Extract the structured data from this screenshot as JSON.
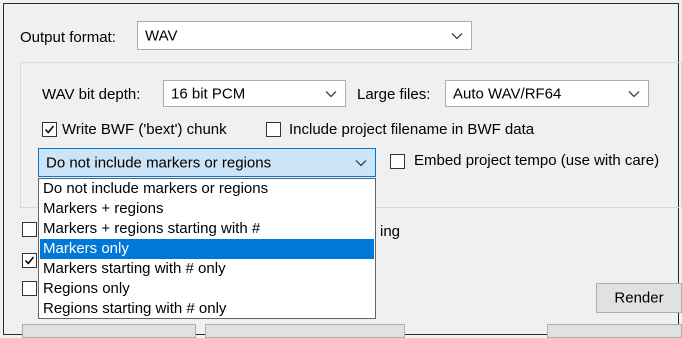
{
  "output_format": {
    "label": "Output format:",
    "value": "WAV"
  },
  "wav": {
    "bit_depth_label": "WAV bit depth:",
    "bit_depth_value": "16 bit PCM",
    "large_files_label": "Large files:",
    "large_files_value": "Auto WAV/RF64"
  },
  "checks": {
    "bwf_label": "Write BWF ('bext') chunk",
    "bwf_checked": true,
    "include_filename_label": "Include project filename in BWF data",
    "include_filename_checked": false,
    "embed_tempo_label": "Embed project tempo (use with care)",
    "embed_tempo_checked": false
  },
  "markers_combo": {
    "value": "Do not include markers or regions"
  },
  "markers_dropdown": {
    "items": [
      "Do not include markers or regions",
      "Markers + regions",
      "Markers + regions starting with #",
      "Markers only",
      "Markers starting with # only",
      "Regions only",
      "Regions starting with # only"
    ],
    "highlighted_index": 3
  },
  "partial_texts": {
    "obscured_suffix": "ing"
  },
  "buttons": {
    "render_label": "Render"
  },
  "colors": {
    "highlight": "#0078d7",
    "accent_border": "#2b2b2b"
  }
}
